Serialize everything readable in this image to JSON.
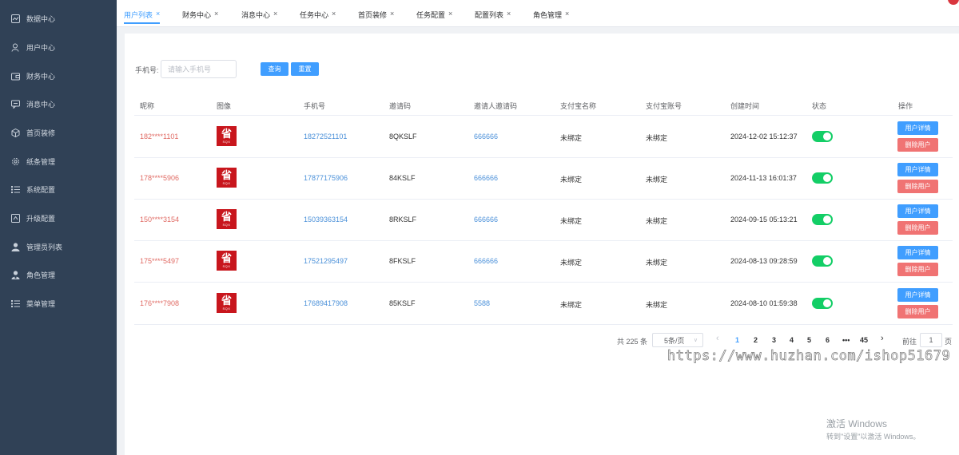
{
  "sidebar": {
    "items": [
      {
        "label": "数据中心",
        "icon": "chart-icon"
      },
      {
        "label": "用户中心",
        "icon": "user-icon"
      },
      {
        "label": "财务中心",
        "icon": "wallet-icon"
      },
      {
        "label": "消息中心",
        "icon": "message-icon"
      },
      {
        "label": "首页装修",
        "icon": "cube-icon"
      },
      {
        "label": "纸条管理",
        "icon": "gear-icon"
      },
      {
        "label": "系统配置",
        "icon": "list-icon"
      },
      {
        "label": "升级配置",
        "icon": "upgrade-icon"
      },
      {
        "label": "管理员列表",
        "icon": "person-icon"
      },
      {
        "label": "角色管理",
        "icon": "role-icon"
      },
      {
        "label": "菜单管理",
        "icon": "menu-icon"
      }
    ]
  },
  "tabs": [
    {
      "label": "用户列表",
      "active": true
    },
    {
      "label": "财务中心"
    },
    {
      "label": "消息中心"
    },
    {
      "label": "任务中心"
    },
    {
      "label": "首页装修"
    },
    {
      "label": "任务配置"
    },
    {
      "label": "配置列表"
    },
    {
      "label": "角色管理"
    }
  ],
  "tab_close": "×",
  "filter": {
    "label": "手机号:",
    "placeholder": "请输入手机号",
    "value": "",
    "search_label": "查询",
    "reset_label": "重置"
  },
  "table": {
    "headers": [
      "昵称",
      "图像",
      "手机号",
      "邀请码",
      "邀请人邀请码",
      "支付宝名称",
      "支付宝账号",
      "创建时间",
      "状态",
      "操作"
    ],
    "avatar_text": {
      "big": "省",
      "small": "SQX"
    },
    "rows": [
      {
        "nickname": "182****1101",
        "phone": "18272521101",
        "invite_code": "8QKSLF",
        "inviter_code": "666666",
        "alipay_name": "未绑定",
        "alipay_account": "未绑定",
        "created": "2024-12-02 15:12:37",
        "enabled": true
      },
      {
        "nickname": "178****5906",
        "phone": "17877175906",
        "invite_code": "84KSLF",
        "inviter_code": "666666",
        "alipay_name": "未绑定",
        "alipay_account": "未绑定",
        "created": "2024-11-13 16:01:37",
        "enabled": true
      },
      {
        "nickname": "150****3154",
        "phone": "15039363154",
        "invite_code": "8RKSLF",
        "inviter_code": "666666",
        "alipay_name": "未绑定",
        "alipay_account": "未绑定",
        "created": "2024-09-15 05:13:21",
        "enabled": true
      },
      {
        "nickname": "175****5497",
        "phone": "17521295497",
        "invite_code": "8FKSLF",
        "inviter_code": "666666",
        "alipay_name": "未绑定",
        "alipay_account": "未绑定",
        "created": "2024-08-13 09:28:59",
        "enabled": true
      },
      {
        "nickname": "176****7908",
        "phone": "17689417908",
        "invite_code": "85KSLF",
        "inviter_code": "5588",
        "alipay_name": "未绑定",
        "alipay_account": "未绑定",
        "created": "2024-08-10 01:59:38",
        "enabled": true
      }
    ],
    "detail_label": "用户详情",
    "delete_label": "删除用户"
  },
  "pagination": {
    "total_text": "共 225 条",
    "page_size": "5条/页",
    "prev": "‹",
    "next": "›",
    "pages": [
      "1",
      "2",
      "3",
      "4",
      "5",
      "6",
      "•••",
      "45"
    ],
    "current": "1",
    "goto_label": "前往",
    "goto_value": "1",
    "page_suffix": "页"
  },
  "watermark": "https://www.huzhan.com/ishop51679",
  "windows_activation": {
    "title": "激活 Windows",
    "subtitle": "转到\"设置\"以激活 Windows。"
  },
  "colors": {
    "sidebar_bg": "#304156",
    "primary": "#409eff",
    "danger": "#f07373",
    "toggle_on": "#13ce66",
    "nickname": "#e06a63"
  }
}
